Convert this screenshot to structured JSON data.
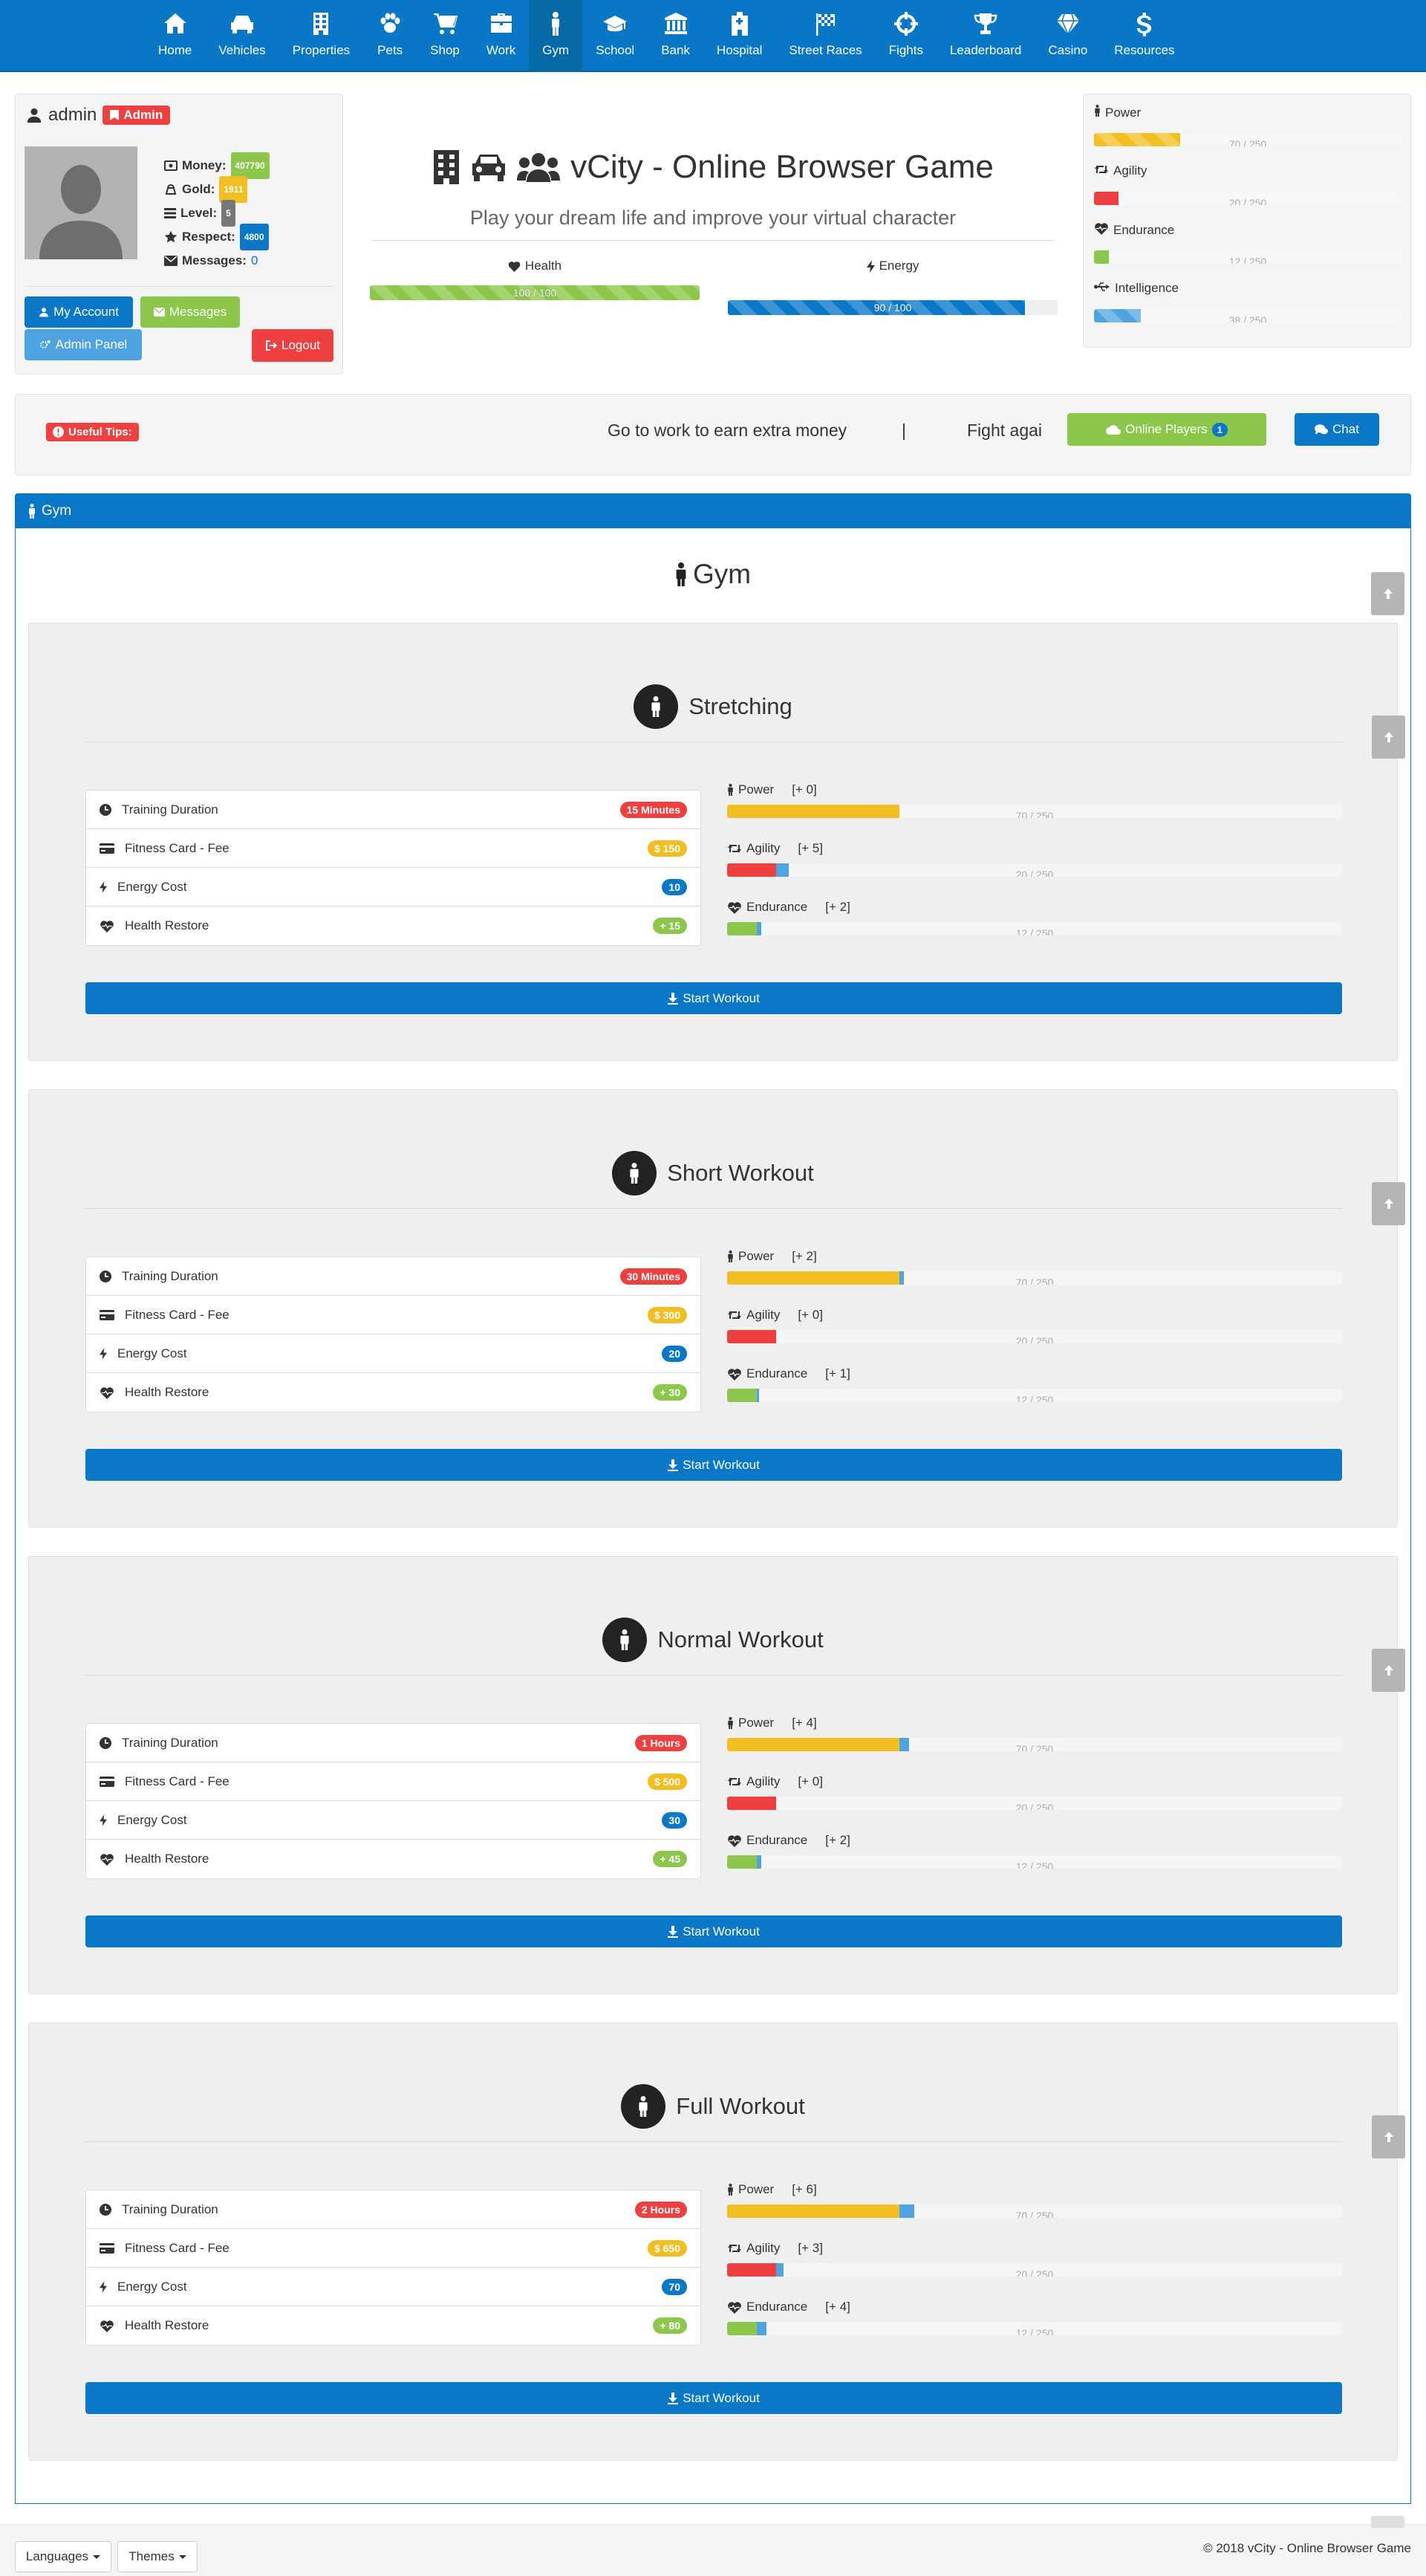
{
  "nav": {
    "items": [
      {
        "label": "Home",
        "icon": "home-icon"
      },
      {
        "label": "Vehicles",
        "icon": "car-icon"
      },
      {
        "label": "Properties",
        "icon": "building-icon"
      },
      {
        "label": "Pets",
        "icon": "paw-icon"
      },
      {
        "label": "Shop",
        "icon": "cart-icon"
      },
      {
        "label": "Work",
        "icon": "briefcase-icon"
      },
      {
        "label": "Gym",
        "icon": "male-icon"
      },
      {
        "label": "School",
        "icon": "graduation-cap-icon"
      },
      {
        "label": "Bank",
        "icon": "bank-icon"
      },
      {
        "label": "Hospital",
        "icon": "hospital-icon"
      },
      {
        "label": "Street Races",
        "icon": "flag-checkered-icon"
      },
      {
        "label": "Fights",
        "icon": "crosshairs-icon"
      },
      {
        "label": "Leaderboard",
        "icon": "trophy-icon"
      },
      {
        "label": "Casino",
        "icon": "diamond-icon"
      },
      {
        "label": "Resources",
        "icon": "dollar-icon"
      }
    ],
    "active": "Gym"
  },
  "user": {
    "name": "admin",
    "role_badge": "Admin",
    "money_label": "Money:",
    "money": "407790",
    "gold_label": "Gold:",
    "gold": "1911",
    "level_label": "Level:",
    "level": "5",
    "respect_label": "Respect:",
    "respect": "4800",
    "messages_label": "Messages:",
    "messages": "0",
    "buttons": {
      "my_account": "My Account",
      "messages": "Messages",
      "admin_panel": "Admin Panel",
      "logout": "Logout"
    }
  },
  "header": {
    "title": "vCity - Online Browser Game",
    "subtitle": "Play your dream life and improve your virtual character",
    "health_label": "Health",
    "health_text": "100 / 100",
    "health_value": 100,
    "health_max": 100,
    "energy_label": "Energy",
    "energy_text": "90 / 100",
    "energy_value": 90,
    "energy_max": 100
  },
  "attributes": [
    {
      "label": "Power",
      "text": "70 / 250",
      "value": 70,
      "max": 250,
      "color": "#f2be22",
      "icon": "male-icon"
    },
    {
      "label": "Agility",
      "text": "20 / 250",
      "value": 20,
      "max": 250,
      "color": "#ee4040",
      "icon": "retweet-icon"
    },
    {
      "label": "Endurance",
      "text": "12 / 250",
      "value": 12,
      "max": 250,
      "color": "#8cc64a",
      "icon": "heartbeat-icon"
    },
    {
      "label": "Intelligence",
      "text": "38 / 250",
      "value": 38,
      "max": 250,
      "color": "#4ea3e0",
      "icon": "usb-icon"
    }
  ],
  "tips": {
    "badge": "Useful Tips:",
    "tip1": "Go to work to earn extra money",
    "separator": "|",
    "tip2": "Fight agai",
    "online_players_label": "Online Players",
    "online_players_count": "1",
    "chat_label": "Chat"
  },
  "gym": {
    "panel_title": "Gym",
    "title": "Gym",
    "row_labels": {
      "duration": "Training Duration",
      "fee": "Fitness Card - Fee",
      "energy": "Energy Cost",
      "health": "Health Restore"
    },
    "stat_labels": {
      "power": "Power",
      "agility": "Agility",
      "endurance": "Endurance"
    },
    "base": {
      "power_text": "70 / 250",
      "power": 70,
      "agility_text": "20 / 250",
      "agility": 20,
      "endurance_text": "12 / 250",
      "endurance": 12,
      "max": 250
    },
    "start_label": "Start Workout",
    "workouts": [
      {
        "name": "Stretching",
        "duration": "15 Minutes",
        "fee": "$ 150",
        "energy": "10",
        "health": "+ 15",
        "power_gain": "[+ 0]",
        "agility_gain": "[+ 5]",
        "endurance_gain": "[+ 2]",
        "power_inc": 0,
        "agility_inc": 5,
        "endurance_inc": 2
      },
      {
        "name": "Short Workout",
        "duration": "30 Minutes",
        "fee": "$ 300",
        "energy": "20",
        "health": "+ 30",
        "power_gain": "[+ 2]",
        "agility_gain": "[+ 0]",
        "endurance_gain": "[+ 1]",
        "power_inc": 2,
        "agility_inc": 0,
        "endurance_inc": 1
      },
      {
        "name": "Normal Workout",
        "duration": "1 Hours",
        "fee": "$ 500",
        "energy": "30",
        "health": "+ 45",
        "power_gain": "[+ 4]",
        "agility_gain": "[+ 0]",
        "endurance_gain": "[+ 2]",
        "power_inc": 4,
        "agility_inc": 0,
        "endurance_inc": 2
      },
      {
        "name": "Full Workout",
        "duration": "2 Hours",
        "fee": "$ 650",
        "energy": "70",
        "health": "+ 80",
        "power_gain": "[+ 6]",
        "agility_gain": "[+ 3]",
        "endurance_gain": "[+ 4]",
        "power_inc": 6,
        "agility_inc": 3,
        "endurance_inc": 4
      }
    ]
  },
  "footer": {
    "languages": "Languages",
    "themes": "Themes",
    "copyright": "© 2018 vCity - Online Browser Game"
  },
  "colors": {
    "primary": "#0a78c6",
    "success": "#8cc64a",
    "danger": "#ee4040",
    "warning": "#f2be22",
    "info": "#4ea3e0"
  }
}
